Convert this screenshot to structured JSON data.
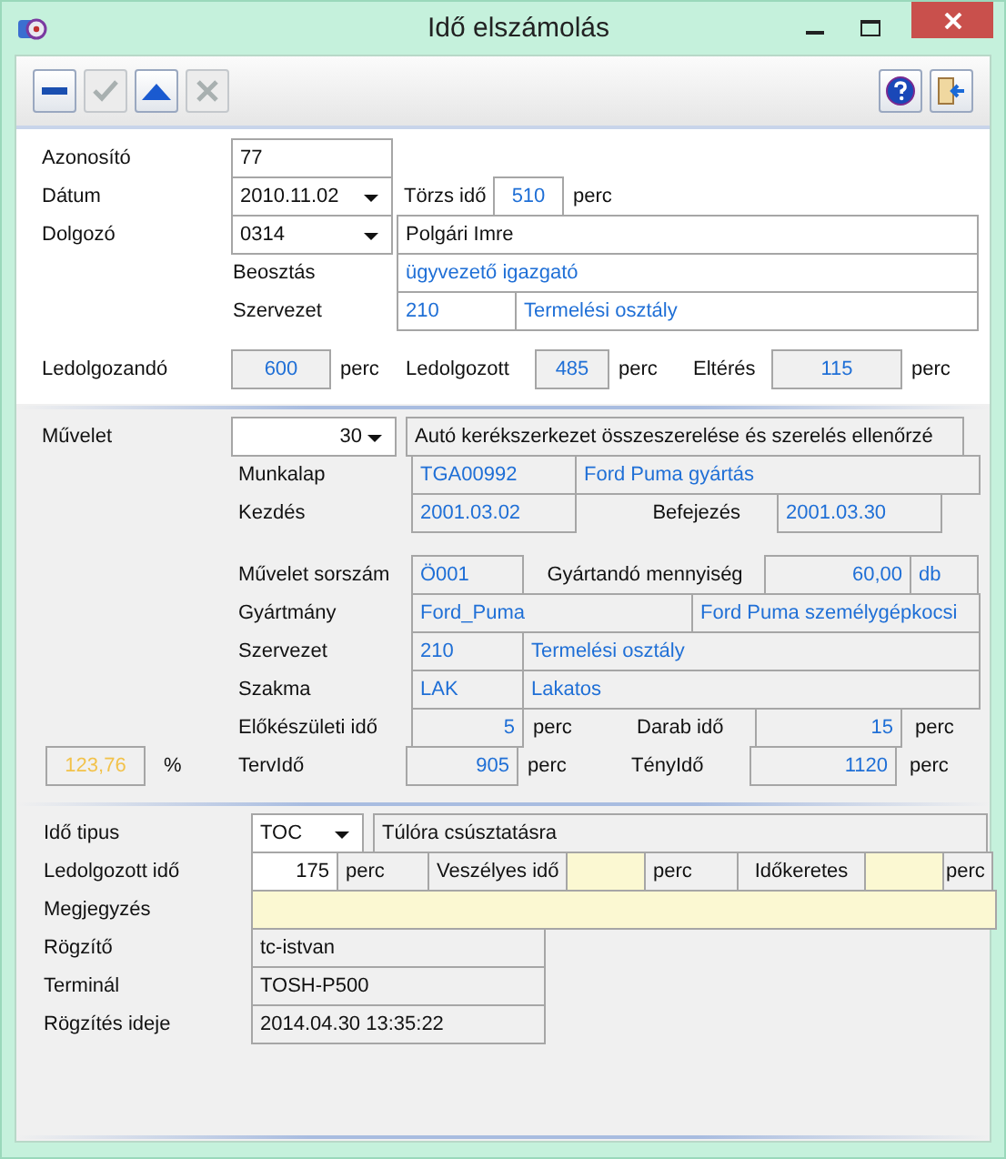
{
  "window": {
    "title": "Idő elszámolás"
  },
  "toolbar": [
    {
      "kind": "minus",
      "disabled": false
    },
    {
      "kind": "check",
      "disabled": true
    },
    {
      "kind": "up",
      "disabled": false
    },
    {
      "kind": "cancel",
      "disabled": true
    },
    {
      "kind": "help",
      "disabled": false
    },
    {
      "kind": "exit",
      "disabled": false
    }
  ],
  "header": {
    "id": {
      "label": "Azonosító",
      "value": "77"
    },
    "date": {
      "label": "Dátum",
      "value": "2010.11.02"
    },
    "base_time": {
      "label": "Törzs idő",
      "value": "510",
      "unit": "perc"
    },
    "employee": {
      "label": "Dolgozó",
      "code": "0314",
      "name": "Polgári Imre"
    },
    "position": {
      "label": "Beosztás",
      "value": "ügyvezető igazgató"
    },
    "organization": {
      "label": "Szervezet",
      "code": "210",
      "name": "Termelési osztály"
    },
    "totals": [
      {
        "label": "Ledolgozandó",
        "value": "600",
        "unit": "perc"
      },
      {
        "label": "Ledolgozott",
        "value": "485",
        "unit": "perc"
      },
      {
        "label": "Eltérés",
        "value": "115",
        "unit": "perc"
      }
    ]
  },
  "operation": {
    "op": {
      "label": "Művelet",
      "code": "30",
      "description": "Autó kerékszerkezet összeszerelése és szerelés ellenőrzé"
    },
    "worksheet": {
      "label": "Munkalap",
      "code": "TGA00992",
      "name": "Ford Puma gyártás"
    },
    "start": {
      "label": "Kezdés",
      "value": "2001.03.02"
    },
    "end": {
      "label": "Befejezés",
      "value": "2001.03.30"
    },
    "sequence": {
      "label": "Művelet sorszám",
      "value": "Ö001"
    },
    "quantity": {
      "label": "Gyártandó mennyiség",
      "value": "60,00",
      "unit": "db"
    },
    "product": {
      "label": "Gyártmány",
      "code": "Ford_Puma",
      "name": "Ford Puma személygépkocsi"
    },
    "organization": {
      "label": "Szervezet",
      "code": "210",
      "name": "Termelési osztály"
    },
    "trade": {
      "label": "Szakma",
      "code": "LAK",
      "name": "Lakatos"
    },
    "setup_time": {
      "label": "Előkészületi idő",
      "value": "5",
      "unit": "perc"
    },
    "piece_time": {
      "label": "Darab idő",
      "value": "15",
      "unit": "perc"
    },
    "planned_time": {
      "label": "TervIdő",
      "value": "905",
      "unit": "perc"
    },
    "actual_time": {
      "label": "TényIdő",
      "value": "1120",
      "unit": "perc"
    },
    "ratio": {
      "value": "123,76",
      "unit": "%"
    }
  },
  "entry": {
    "time_type": {
      "label": "Idő tipus",
      "code": "TOC",
      "name": "Túlóra csúsztatásra"
    },
    "worked": {
      "label": "Ledolgozott idő",
      "value": "175",
      "unit": "perc"
    },
    "hazard": {
      "label": "Veszélyes idő",
      "unit": "perc"
    },
    "time_frame": {
      "label": "Időkeretes",
      "unit": "perc"
    },
    "note": {
      "label": "Megjegyzés"
    },
    "recorder": {
      "label": "Rögzítő",
      "value": "tc-istvan"
    },
    "terminal": {
      "label": "Terminál",
      "value": "TOSH-P500"
    },
    "recorded_at": {
      "label": "Rögzítés ideje",
      "value": "2014.04.30 13:35:22"
    }
  }
}
